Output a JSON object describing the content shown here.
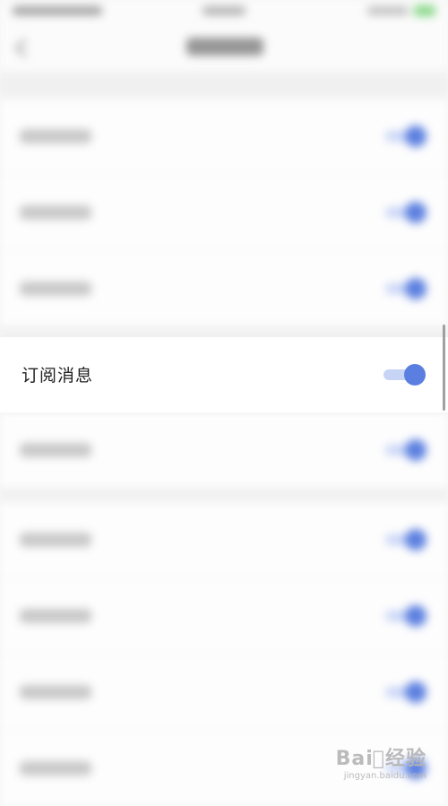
{
  "focused_setting": {
    "label": "订阅消息",
    "enabled": true
  },
  "colors": {
    "accent": "#5b7fe0",
    "accent_track": "#c7d4f5",
    "background": "#f6f6f6",
    "row_background": "#ffffff"
  },
  "watermark": {
    "brand": "Bai⃝经验",
    "domain": "jingyan.baidu.com"
  },
  "icons": [
    "back-arrow-icon",
    "toggle-switch-icon",
    "battery-icon"
  ]
}
